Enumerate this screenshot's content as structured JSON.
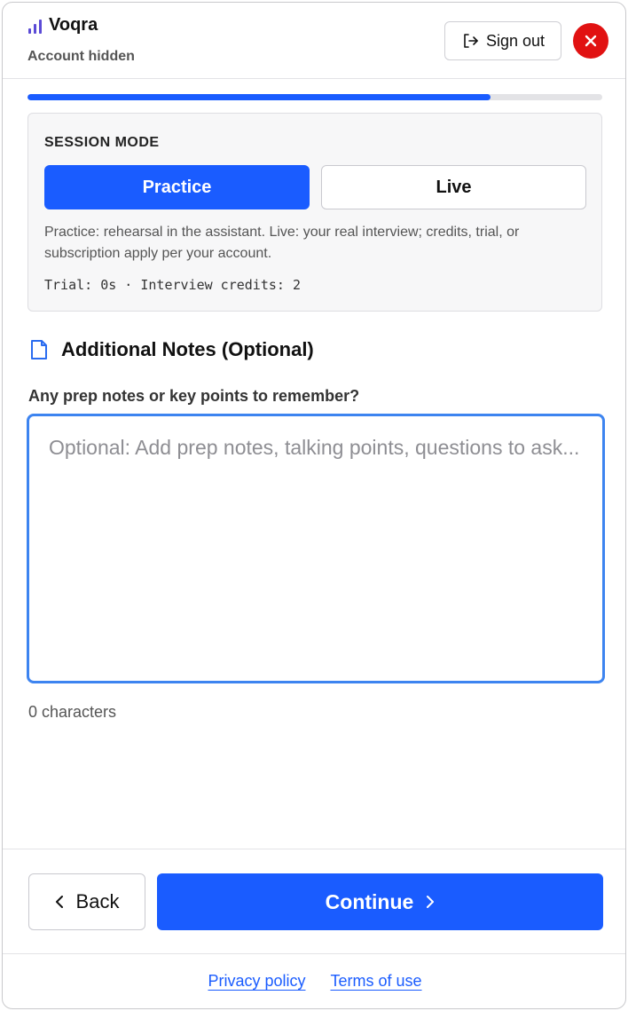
{
  "header": {
    "app_name": "Voqra",
    "account_text": "Account hidden",
    "sign_out_label": "Sign out",
    "close_icon": "close-icon",
    "brand_icon": "signal-bars-icon"
  },
  "progress": {
    "fraction": 0.805,
    "color": "#1a5cff"
  },
  "session_mode": {
    "title": "SESSION MODE",
    "options": [
      {
        "label": "Practice",
        "selected": true
      },
      {
        "label": "Live",
        "selected": false
      }
    ],
    "description": "Practice: rehearsal in the assistant. Live: your real interview; credits, trial, or subscription apply per your account.",
    "meta": "Trial: 0s · Interview credits: 2"
  },
  "notes": {
    "icon": "document-icon",
    "title": "Additional Notes (Optional)",
    "label": "Any prep notes or key points to remember?",
    "value": "",
    "placeholder": "Optional: Add prep notes, talking points, questions to ask...",
    "char_count": "0 characters"
  },
  "footer": {
    "back_label": "Back",
    "continue_label": "Continue",
    "links": [
      "Privacy policy",
      "Terms of use"
    ]
  },
  "colors": {
    "accent": "#1a5cff",
    "close": "#e11212",
    "brand_icon": "#5b4bd6"
  }
}
